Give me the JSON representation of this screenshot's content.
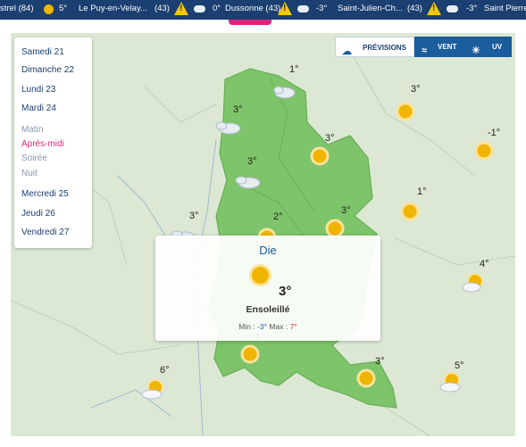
{
  "ticker": {
    "items": [
      {
        "text": "strel (84)"
      },
      {
        "text": "5°"
      },
      {
        "text": "Le Puy-en-Velay..."
      },
      {
        "text": "(43)"
      },
      {
        "text": "0°"
      },
      {
        "text": "Dussonne (43)"
      },
      {
        "text": "-3°"
      },
      {
        "text": "Saint-Julien-Ch..."
      },
      {
        "text": "(43)"
      },
      {
        "text": "-3°"
      },
      {
        "text": "Saint Pierre de"
      }
    ]
  },
  "legend": {
    "days": [
      "Samedi 21",
      "Dimanche 22",
      "Lundi 23",
      "Mardi 24"
    ],
    "periods": [
      "Matin",
      "Après-midi",
      "Soirée",
      "Nuit"
    ],
    "selected_period": "Après-midi",
    "days_after": [
      "Mercredi 25",
      "Jeudi 26",
      "Vendredi 27"
    ]
  },
  "tabs": [
    {
      "label": "PRÉVISIONS",
      "icon": "cloud-sun-icon"
    },
    {
      "label": "VENT",
      "icon": "wind-icon"
    },
    {
      "label": "UV",
      "icon": "uv-sun-icon"
    }
  ],
  "markers": [
    {
      "temp": "1°",
      "icon": "cloudy"
    },
    {
      "temp": "3°",
      "icon": "sunny"
    },
    {
      "temp": "3°",
      "icon": "cloudy"
    },
    {
      "temp": "3°",
      "icon": "sunny"
    },
    {
      "temp": "-1°",
      "icon": "sunny"
    },
    {
      "temp": "3°",
      "icon": "cloudy"
    },
    {
      "temp": "1°",
      "icon": "sunny"
    },
    {
      "temp": "3°",
      "icon": "cloudy"
    },
    {
      "temp": "2°",
      "icon": "sunny"
    },
    {
      "temp": "3°",
      "icon": "sunny"
    },
    {
      "temp": "4°",
      "icon": "partly-cloudy"
    },
    {
      "temp": "4°",
      "icon": "sunny"
    },
    {
      "temp": "6°",
      "icon": "partly-cloudy"
    },
    {
      "temp": "3°",
      "icon": "sunny"
    },
    {
      "temp": "5°",
      "icon": "partly-cloudy"
    }
  ],
  "popup": {
    "city": "Die",
    "temp": "3°",
    "condition": "Ensoleillé",
    "min_label": "Min : ",
    "min": "-3°",
    "max_label": " Max : ",
    "max": "7°"
  },
  "colors": {
    "header_bg": "#1a3f70",
    "accent_pink": "#e0247a",
    "map_land": "#dce8d4",
    "dept_fill": "#7ec46a",
    "tab_active": "#1a5c9c",
    "sun": "#f0b500"
  }
}
